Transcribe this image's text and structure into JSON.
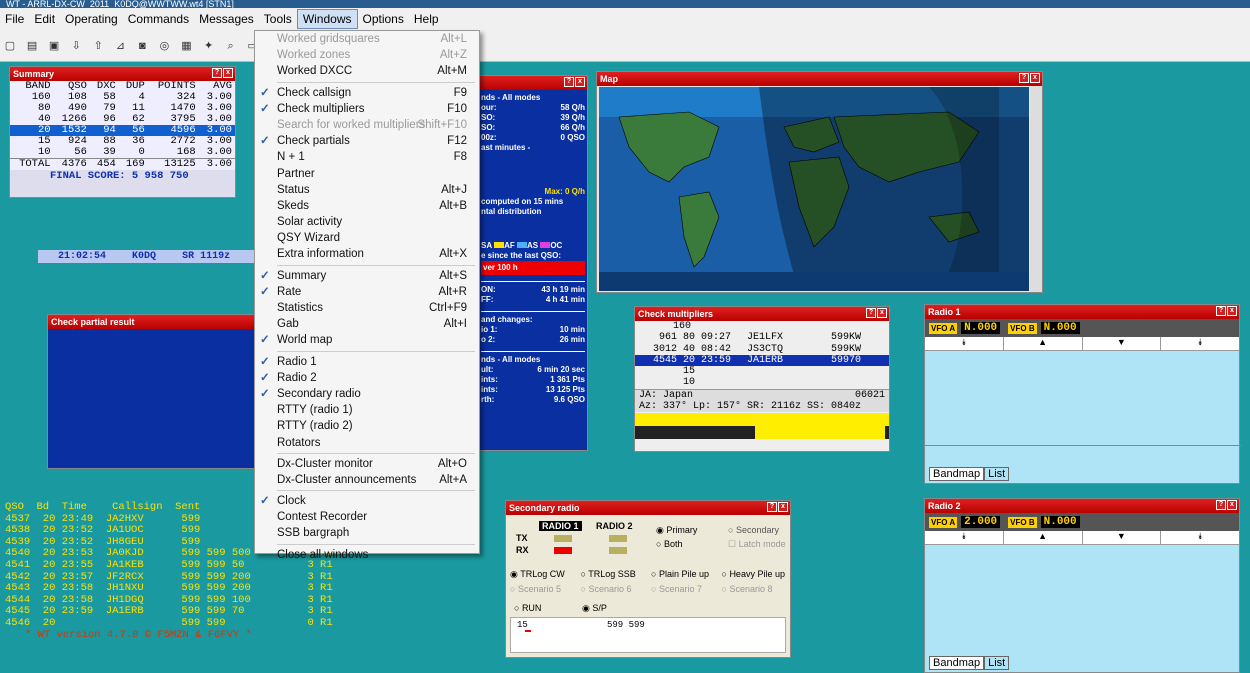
{
  "window_title": "WT - ARRL-DX-CW_2011_K0DQ@WWTWW.wt4 [STN1]",
  "menubar": [
    "File",
    "Edit",
    "Operating",
    "Commands",
    "Messages",
    "Tools",
    "Windows",
    "Options",
    "Help"
  ],
  "windows_menu": [
    {
      "label": "Worked gridsquares",
      "shortcut": "Alt+L",
      "disabled": true,
      "check": false
    },
    {
      "label": "Worked zones",
      "shortcut": "Alt+Z",
      "disabled": true,
      "check": false
    },
    {
      "label": "Worked DXCC",
      "shortcut": "Alt+M",
      "disabled": false,
      "check": false
    },
    {
      "sep": true
    },
    {
      "label": "Check callsign",
      "shortcut": "F9",
      "check": true
    },
    {
      "label": "Check multipliers",
      "shortcut": "F10",
      "check": true
    },
    {
      "label": "Search for worked multipliers",
      "shortcut": "Shift+F10",
      "disabled": true
    },
    {
      "label": "Check partials",
      "shortcut": "F12",
      "check": true
    },
    {
      "label": "N + 1",
      "shortcut": "F8"
    },
    {
      "label": "Partner",
      "shortcut": ""
    },
    {
      "label": "Status",
      "shortcut": "Alt+J"
    },
    {
      "label": "Skeds",
      "shortcut": "Alt+B"
    },
    {
      "label": "Solar activity",
      "shortcut": ""
    },
    {
      "label": "QSY Wizard",
      "shortcut": ""
    },
    {
      "label": "Extra information",
      "shortcut": "Alt+X"
    },
    {
      "sep": true
    },
    {
      "label": "Summary",
      "shortcut": "Alt+S",
      "check": true
    },
    {
      "label": "Rate",
      "shortcut": "Alt+R",
      "check": true
    },
    {
      "label": "Statistics",
      "shortcut": "Ctrl+F9"
    },
    {
      "label": "Gab",
      "shortcut": "Alt+I"
    },
    {
      "label": "World map",
      "shortcut": "",
      "check": true
    },
    {
      "sep": true
    },
    {
      "label": "Radio 1",
      "shortcut": "",
      "check": true
    },
    {
      "label": "Radio 2",
      "shortcut": "",
      "check": true
    },
    {
      "label": "Secondary radio",
      "shortcut": "",
      "check": true
    },
    {
      "label": "RTTY (radio 1)",
      "shortcut": ""
    },
    {
      "label": "RTTY (radio 2)",
      "shortcut": ""
    },
    {
      "label": "Rotators",
      "shortcut": ""
    },
    {
      "sep": true
    },
    {
      "label": "Dx-Cluster monitor",
      "shortcut": "Alt+O"
    },
    {
      "label": "Dx-Cluster announcements",
      "shortcut": "Alt+A"
    },
    {
      "sep": true
    },
    {
      "label": "Clock",
      "shortcut": "",
      "check": true
    },
    {
      "label": "Contest Recorder",
      "shortcut": ""
    },
    {
      "label": "SSB bargraph",
      "shortcut": ""
    },
    {
      "sep": true
    },
    {
      "label": "Close all windows",
      "shortcut": ""
    }
  ],
  "summary": {
    "title": "Summary",
    "headers": [
      "BAND",
      "QSO",
      "DXC",
      "DUP",
      "POINTS",
      "AVG"
    ],
    "rows": [
      [
        "160",
        "108",
        "58",
        "4",
        "324",
        "3.00"
      ],
      [
        "80",
        "490",
        "79",
        "11",
        "1470",
        "3.00"
      ],
      [
        "40",
        "1266",
        "96",
        "62",
        "3795",
        "3.00"
      ],
      [
        "20",
        "1532",
        "94",
        "56",
        "4596",
        "3.00"
      ],
      [
        "15",
        "924",
        "88",
        "36",
        "2772",
        "3.00"
      ],
      [
        "10",
        "56",
        "39",
        "0",
        "168",
        "3.00"
      ]
    ],
    "total": [
      "TOTAL",
      "4376",
      "454",
      "169",
      "13125",
      "3.00"
    ],
    "final_score": "FINAL SCORE: 5 958 750"
  },
  "clock": {
    "time": "21:02:54",
    "call": "K0DQ",
    "sr": "SR 1119z"
  },
  "partial": {
    "title": "Check partial result"
  },
  "rate": {
    "lines1": [
      "nds - All modes"
    ],
    "rows1": [
      [
        "our:",
        "58 Q/h"
      ],
      [
        "SO:",
        "39 Q/h"
      ],
      [
        "SO:",
        "66 Q/h"
      ],
      [
        "00z:",
        "0 QSO"
      ]
    ],
    "lastmin": "ast minutes -",
    "max": "Max: 0 Q/h",
    "computed": "computed on 15 mins",
    "distribution": "ntal distribution",
    "legend": [
      "SA",
      "AF",
      "AS",
      "OC"
    ],
    "since": "e since the last QSO:",
    "over": "ver 100 h",
    "on": [
      "ON:",
      "43 h 19 min"
    ],
    "off": [
      "FF:",
      "4 h 41 min"
    ],
    "band_changes": "and changes:",
    "bc1": [
      "io 1:",
      "10 min"
    ],
    "bc2": [
      "o 2:",
      "26 min"
    ],
    "nds2": "nds - All modes",
    "rows2": [
      [
        "ult:",
        "6 min 20 sec"
      ],
      [
        "ints:",
        "1 361 Pts"
      ],
      [
        "ints:",
        "13 125 Pts"
      ],
      [
        "rth:",
        "9.6 QSO"
      ]
    ]
  },
  "map": {
    "title": "Map"
  },
  "checkmult": {
    "title": "Check multipliers",
    "rows": [
      [
        "160",
        "",
        "",
        ""
      ],
      [
        "961",
        "80 09:27",
        "JE1LFX",
        "599KW"
      ],
      [
        "3012",
        "40 08:42",
        "JS3CTQ",
        "599KW"
      ],
      [
        "4545",
        "20 23:59",
        "JA1ERB",
        "59970"
      ],
      [
        "",
        "15",
        "",
        ""
      ],
      [
        "",
        "10",
        "",
        ""
      ]
    ],
    "country": "JA: Japan",
    "num": "06021",
    "az": "Az: 337°  Lp: 157°  SR: 2116z SS: 0840z"
  },
  "radio1": {
    "title": "Radio 1",
    "vfoa": "VFO A",
    "vfob": "VFO B",
    "fa": "N.000",
    "fb": "N.000",
    "tabs": [
      "Bandmap",
      "List"
    ]
  },
  "radio2": {
    "title": "Radio 2",
    "vfoa": "VFO A",
    "vfob": "VFO B",
    "fa": "2.000",
    "fb": "N.000",
    "tabs": [
      "Bandmap",
      "List"
    ]
  },
  "secradio": {
    "title": "Secondary radio",
    "r1": "RADIO 1",
    "r2": "RADIO 2",
    "tx": "TX",
    "rx": "RX",
    "primary": "Primary",
    "secondary": "Secondary",
    "both": "Both",
    "latch": "Latch mode",
    "opts": [
      "TRLog CW",
      "TRLog SSB",
      "Plain Pile up",
      "Heavy Pile up"
    ],
    "scen": [
      "Scenario 5",
      "Scenario 6",
      "Scenario 7",
      "Scenario 8"
    ],
    "run": "RUN",
    "sp": "S/P",
    "entry": "15",
    "rst": "599 599"
  },
  "log": {
    "headers": "QSO  Bd  Time    Callsign  Sent",
    "rows": [
      "4537  20 23:49  JA2HXV      599",
      "4538  20 23:52  JA1UOC      599",
      "4539  20 23:52  JH8GEU      599",
      "4540  20 23:53  JA0KJD      599 599 500         3 R1",
      "4541  20 23:55  JA1KEB      599 599 50          3 R1",
      "4542  20 23:57  JF2RCX      599 599 200         3 R1",
      "4543  20 23:58  JH1NXU      599 599 200         3 R1",
      "4544  20 23:58  JH1DGQ      599 599 100         3 R1",
      "4545  20 23:59  JA1ERB      599 599 70          3 R1",
      "4546  20                    599 599             0 R1"
    ],
    "footer": "* WT version 4.7.0 © F5MZN & F6FVY *"
  }
}
